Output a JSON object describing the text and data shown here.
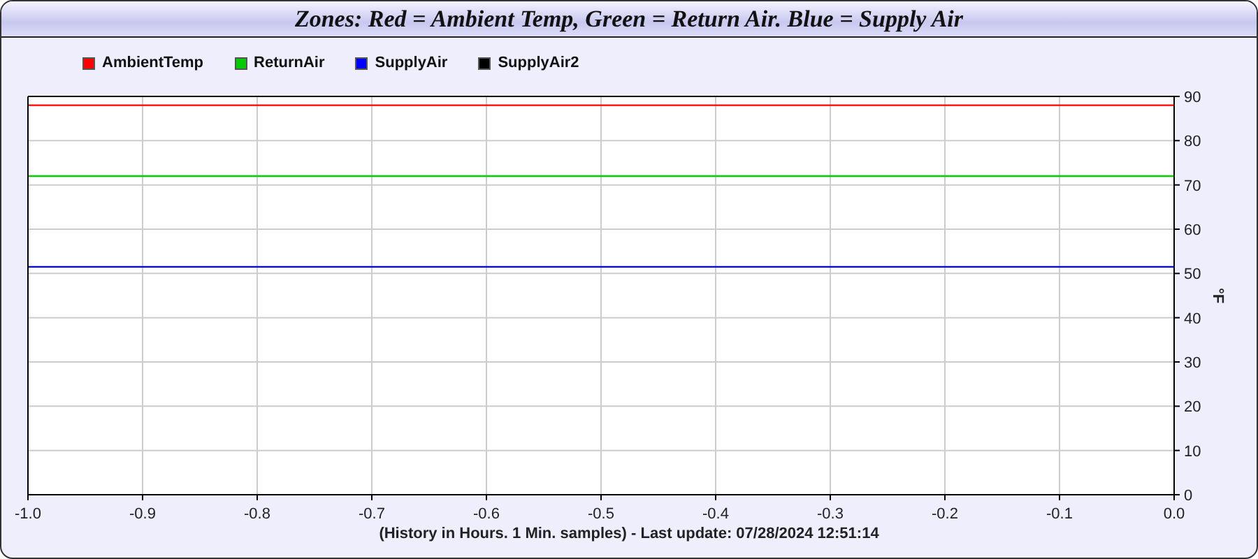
{
  "window": {
    "title": "Zones: Red = Ambient Temp, Green = Return Air. Blue = Supply Air"
  },
  "chart": {
    "chart_data": {
      "type": "line",
      "xlabel": "(History in Hours. 1 Min. samples) - Last update: 07/28/2024 12:51:14",
      "ylabel": "°F",
      "x": [
        -1,
        0
      ],
      "series": [
        {
          "name": "AmbientTemp",
          "color": "#ff0000",
          "values": [
            88,
            88
          ]
        },
        {
          "name": "ReturnAir",
          "color": "#00cc00",
          "values": [
            72,
            72
          ]
        },
        {
          "name": "SupplyAir",
          "color": "#0000ff",
          "values": [
            51.5,
            51.5
          ]
        },
        {
          "name": "SupplyAir2",
          "color": "#000000",
          "values": [
            null,
            null
          ]
        }
      ],
      "grid": true,
      "xlim": [
        -1,
        0
      ],
      "ylim": [
        0,
        90
      ],
      "xticks": [
        {
          "value": -1,
          "label": "-1.0"
        },
        {
          "value": -0.9,
          "label": "-0.9"
        },
        {
          "value": -0.8,
          "label": "-0.8"
        },
        {
          "value": -0.7,
          "label": "-0.7"
        },
        {
          "value": -0.6,
          "label": "-0.6"
        },
        {
          "value": -0.5,
          "label": "-0.5"
        },
        {
          "value": -0.4,
          "label": "-0.4"
        },
        {
          "value": -0.3,
          "label": "-0.3"
        },
        {
          "value": -0.2,
          "label": "-0.2"
        },
        {
          "value": -0.1,
          "label": "-0.1"
        },
        {
          "value": 0,
          "label": "0.0"
        }
      ],
      "yticks": [
        0,
        10,
        20,
        30,
        40,
        50,
        60,
        70,
        80,
        90
      ]
    }
  }
}
